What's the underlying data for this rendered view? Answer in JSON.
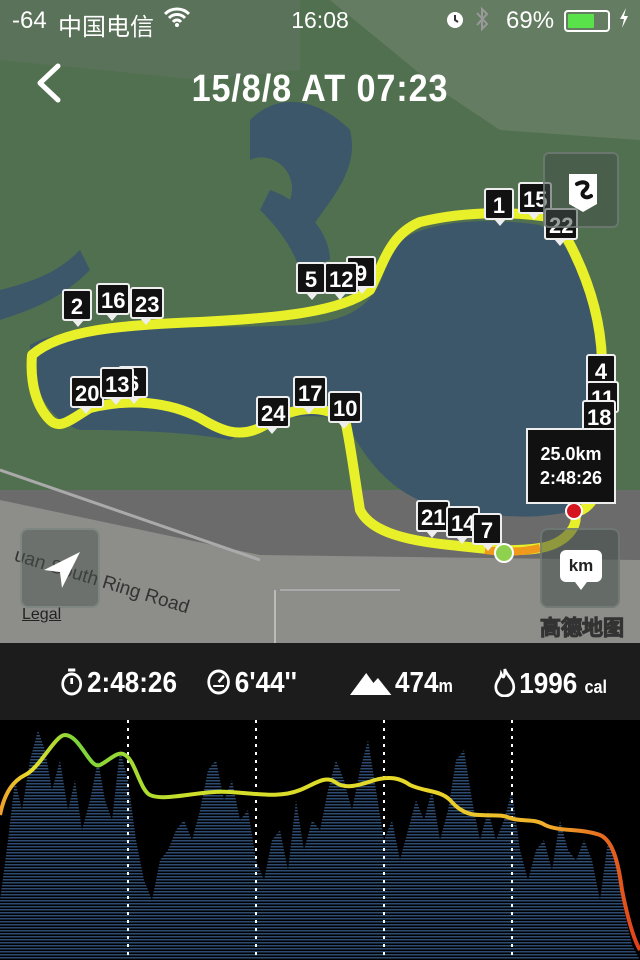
{
  "status_bar": {
    "signal": "-64",
    "carrier": "中国电信",
    "time": "16:08",
    "battery_percent": "69%",
    "battery_level": 0.69
  },
  "header": {
    "title": "15/8/8 AT 07:23"
  },
  "map": {
    "road_label": "uan South Ring Road",
    "legal_link": "Legal",
    "provider": "高德地图",
    "unit_button": "km",
    "tooltip": {
      "distance": "25.0km",
      "duration": "2:48:26"
    },
    "markers": [
      "1",
      "15",
      "22",
      "5",
      "12",
      "9",
      "2",
      "16",
      "23",
      "20",
      "13",
      "6",
      "17",
      "24",
      "10",
      "4",
      "11",
      "18",
      "21",
      "14",
      "7"
    ]
  },
  "stats": {
    "duration": "2:48:26",
    "pace": "6'44''",
    "elevation_value": "474",
    "elevation_unit": "m",
    "calories_value": "1996",
    "calories_unit": "cal"
  },
  "colors": {
    "route": "#e8f02a",
    "start_dot": "#8fd14f",
    "end_dot": "#d6161e",
    "water": "#3d5a6e",
    "land": "#4e6b52"
  }
}
